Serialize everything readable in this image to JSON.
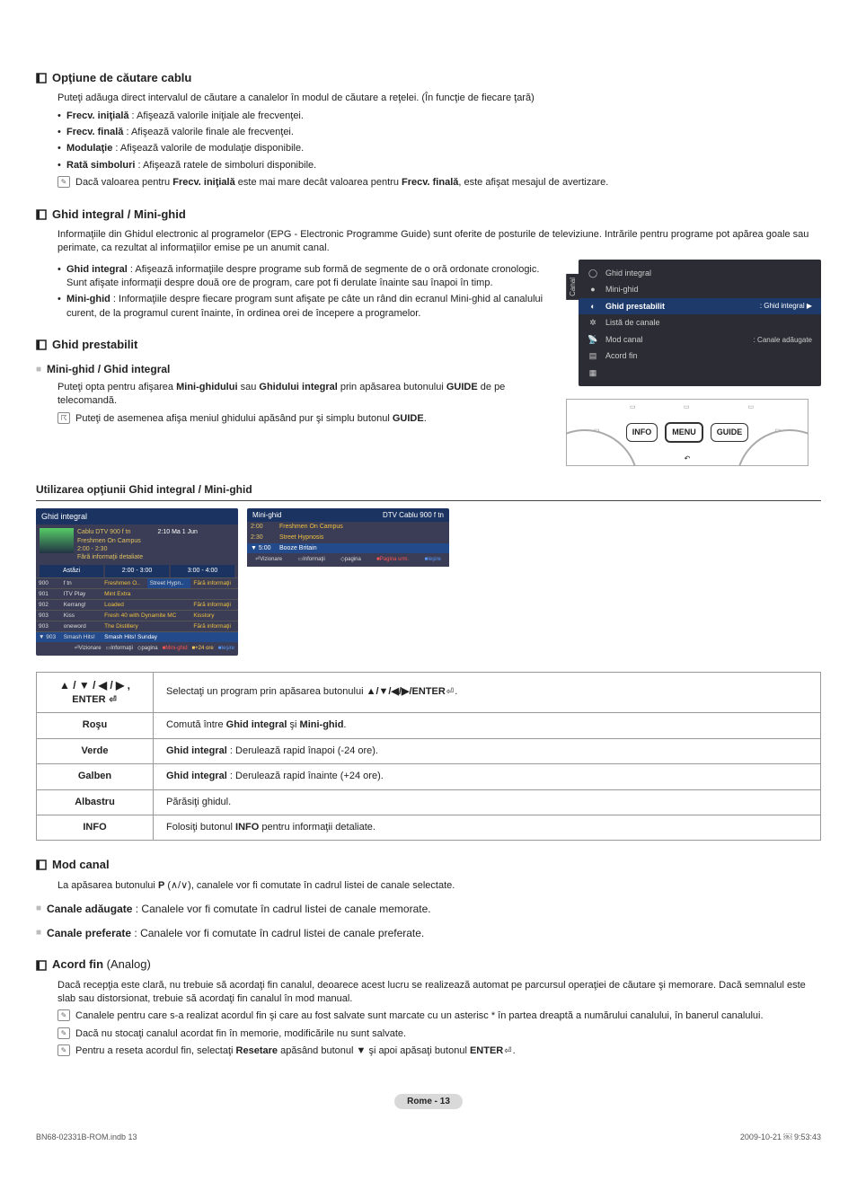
{
  "s1": {
    "title": "Opţiune de căutare cablu",
    "intro": "Puteţi adăuga direct intervalul de căutare a canalelor în modul de căutare a reţelei. (În funcţie de fiecare ţară)",
    "b1_label": "Frecv. iniţială",
    "b1_text": " : Afişează valorile iniţiale ale frecvenţei.",
    "b2_label": "Frecv. finală",
    "b2_text": " : Afişează valorile finale ale frecvenţei.",
    "b3_label": "Modulaţie",
    "b3_text": " : Afişează valorile de modulaţie disponibile.",
    "b4_label": "Rată simboluri",
    "b4_text": " : Afişează ratele de simboluri disponibile.",
    "note_pre": "Dacă valoarea pentru ",
    "note_b1": "Frecv. iniţială",
    "note_mid": " este mai mare decât valoarea pentru ",
    "note_b2": "Frecv. finală",
    "note_post": ", este afişat mesajul de avertizare."
  },
  "s2": {
    "title": "Ghid integral / Mini-ghid",
    "intro": "Informaţiile din Ghidul electronic al programelor (EPG - Electronic Programme Guide) sunt oferite de posturile de televiziune. Intrările pentru programe pot apărea goale sau perimate, ca rezultat al informaţiilor emise pe un anumit canal.",
    "b1_label": "Ghid integral",
    "b1_text": " : Afişează informaţiile despre programe sub formă de segmente de o oră ordonate cronologic. Sunt afişate informaţii despre două ore de program, care pot fi derulate înainte sau înapoi în timp.",
    "b2_label": "Mini-ghid",
    "b2_text": " : Informaţiile despre fiecare program sunt afişate pe câte un rând din ecranul Mini-ghid al canalului curent, de la programul curent înainte, în ordinea orei de începere a programelor."
  },
  "s3": {
    "title": "Ghid prestabilit",
    "sub": "Mini-ghid / Ghid integral",
    "p_pre": "Puteţi opta pentru afişarea ",
    "p_b1": "Mini-ghidului",
    "p_mid": " sau ",
    "p_b2": "Ghidului integral",
    "p_post_pre": " prin apăsarea butonului ",
    "p_b3": "GUIDE",
    "p_post": " de pe telecomandă.",
    "note": "Puteţi de asemenea afişa meniul ghidului apăsând pur şi simplu butonul ",
    "note_b": "GUIDE",
    "note_post": "."
  },
  "menu": {
    "tab": "Canal",
    "i1": "Ghid integral",
    "i2": "Mini-ghid",
    "i3": "Ghid prestabilit",
    "i3r": ": Ghid integral ▶",
    "i4": "Listă de canale",
    "i5": "Mod canal",
    "i5r": ": Canale adăugate",
    "i6": "Acord fin"
  },
  "remote": {
    "b1": "INFO",
    "b2": "MENU",
    "b3": "GUIDE"
  },
  "use_title": "Utilizarea opţiunii Ghid integral / Mini-ghid",
  "shot1": {
    "title": "Ghid integral",
    "ch": "Cablu DTV 900 f tn",
    "time": "2:10 Ma 1 Jun",
    "prog": "Freshmen On Campus",
    "slot": "2:00 - 2:30",
    "noinfo": "Fără informaţii detaliate",
    "tab1": "Astăzi",
    "tab2": "2:00 - 3:00",
    "tab3": "3:00 - 4:00",
    "rows": [
      {
        "n": "900",
        "c": "f tn",
        "p1": "Freshmen O..",
        "p2": "Street Hypn..",
        "p3": "Fără informaţii"
      },
      {
        "n": "901",
        "c": "ITV Play",
        "p1": "Mint Extra",
        "p2": "",
        "p3": ""
      },
      {
        "n": "902",
        "c": "Kerrang!",
        "p1": "Loaded",
        "p2": "",
        "p3": "Fără informaţii"
      },
      {
        "n": "903",
        "c": "Kiss",
        "p1": "Fresh 40 with Dynamite MC",
        "p2": "Kisstory",
        "p3": ""
      },
      {
        "n": "903",
        "c": "oneword",
        "p1": "The Distillery",
        "p2": "",
        "p3": "Fără informaţii"
      },
      {
        "n": "▼ 903",
        "c": "Smash Hits!",
        "p1": "Smash Hits! Sunday",
        "p2": "",
        "p3": ""
      }
    ],
    "f1": "Vizionare",
    "f2": "Informaţii",
    "f3": "pagina",
    "f4": "Mini-ghid",
    "f5": "+24 ore",
    "f6": "Ieşire"
  },
  "shot2": {
    "title": "Mini-ghid",
    "title_r": "DTV Cablu 900 f tn",
    "rows": [
      {
        "t": "2:00",
        "p": "Freshmen On Campus"
      },
      {
        "t": "2:30",
        "p": "Street Hypnosis"
      },
      {
        "t": "▼ 5:00",
        "p": "Booze Britain"
      }
    ],
    "f1": "Vizionare",
    "f2": "Informaţii",
    "f3": "pagina",
    "f4": "Pagina urm.",
    "f5": "Ieşire"
  },
  "table": {
    "r1k": "▲ / ▼ / ◀ / ▶ ,",
    "r1k2": "ENTER",
    "r1v_pre": "Selectaţi un program prin apăsarea butonului ",
    "r1v_b": "▲/▼/◀/▶/ENTER",
    "r1v_post": ".",
    "r2k": "Roşu",
    "r2v_pre": "Comută între ",
    "r2v_b1": "Ghid integral",
    "r2v_mid": " şi ",
    "r2v_b2": "Mini-ghid",
    "r2v_post": ".",
    "r3k": "Verde",
    "r3v_b": "Ghid integral",
    "r3v": " : Derulează rapid înapoi (-24 ore).",
    "r4k": "Galben",
    "r4v_b": "Ghid integral",
    "r4v": " : Derulează rapid înainte (+24 ore).",
    "r5k": "Albastru",
    "r5v": "Părăsiţi ghidul.",
    "r6k": "INFO",
    "r6v_pre": "Folosiţi butonul ",
    "r6v_b": "INFO",
    "r6v_post": " pentru informaţii detaliate."
  },
  "s4": {
    "title": "Mod canal",
    "intro_pre": "La apăsarea butonului ",
    "intro_b": "P",
    "intro_post": " (∧/∨), canalele vor fi comutate în cadrul listei de canale selectate.",
    "b1_label": "Canale adăugate",
    "b1_text": " : Canalele vor fi comutate în cadrul listei de canale memorate.",
    "b2_label": "Canale preferate",
    "b2_text": " : Canalele vor fi comutate în cadrul listei de canale preferate."
  },
  "s5": {
    "title_main": "Acord fin ",
    "title_sub": "(Analog)",
    "intro": "Dacă recepţia este clară, nu trebuie să acordaţi fin canalul, deoarece acest lucru se realizează automat pe parcursul operaţiei de căutare şi memorare. Dacă semnalul este slab sau distorsionat, trebuie să acordaţi fin canalul în mod manual.",
    "n1": "Canalele pentru care s-a realizat acordul fin şi care au fost salvate sunt marcate cu un asterisc * în partea dreaptă a numărului canalului, în banerul canalului.",
    "n2": "Dacă nu stocaţi canalul acordat fin în memorie, modificările nu sunt salvate.",
    "n3_pre": "Pentru a reseta acordul fin, selectaţi ",
    "n3_b1": "Resetare",
    "n3_mid": " apăsând butonul ▼ şi apoi apăsaţi butonul ",
    "n3_b2": "ENTER",
    "n3_post": "."
  },
  "footer": "Rome - 13",
  "meta_l": "BN68-02331B-ROM.indb   13",
  "meta_r": "2009-10-21   ￼ 9:53:43"
}
